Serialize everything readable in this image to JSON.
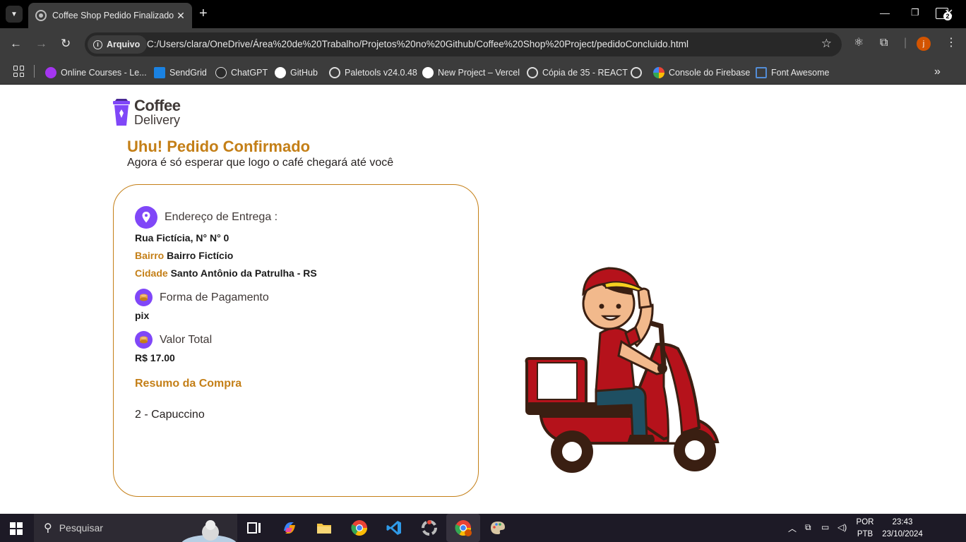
{
  "browser": {
    "tab_title": "Coffee Shop Pedido Finalizado",
    "site_info_label": "Arquivo",
    "url": "C:/Users/clara/OneDrive/Área%20de%20Trabalho/Projetos%20no%20Github/Coffee%20Shop%20Project/pedidoConcluido.html",
    "profile_initial": "j",
    "bookmarks": [
      {
        "label": "Online Courses - Le...",
        "icon": "udemy-icon",
        "color": "#a435f0"
      },
      {
        "label": "SendGrid",
        "icon": "sendgrid-icon",
        "color": "#1a82e2"
      },
      {
        "label": "ChatGPT",
        "icon": "chatgpt-icon",
        "color": "#dddddd"
      },
      {
        "label": "GitHub",
        "icon": "github-icon",
        "color": "#ffffff"
      },
      {
        "label": "Paletools v24.0.48",
        "icon": "globe-icon",
        "color": "#dddddd"
      },
      {
        "label": "New Project – Vercel",
        "icon": "vercel-icon",
        "color": "#ffffff"
      },
      {
        "label": "Cópia de 35 - REACT",
        "icon": "globe-icon",
        "color": "#dddddd"
      },
      {
        "label": "",
        "icon": "globe-icon",
        "color": "#dddddd"
      },
      {
        "label": "Console do Firebase",
        "icon": "google-icon",
        "color": "#4285f4"
      },
      {
        "label": "Font Awesome",
        "icon": "flag-icon",
        "color": "#538dd7"
      }
    ]
  },
  "page": {
    "logo_line1": "Coffee",
    "logo_line2": "Delivery",
    "title": "Uhu! Pedido Confirmado",
    "subtitle": "Agora é só esperar que logo o café chegará até você",
    "address_label": "Endereço de Entrega :",
    "street": "Rua Fictícia, N° N° 0",
    "bairro_label": "Bairro",
    "bairro_value": "Bairro Fictício",
    "cidade_label": "Cidade",
    "cidade_value": "Santo Antônio da Patrulha - RS",
    "payment_label": "Forma de Pagamento",
    "payment_value": "pix",
    "total_label": "Valor Total",
    "total_value": "R$ 17.00",
    "summary_title": "Resumo da Compra",
    "items": [
      "2 - Capuccino"
    ]
  },
  "taskbar": {
    "search_placeholder": "Pesquisar",
    "lang_line1": "POR",
    "lang_line2": "PTB",
    "time": "23:43",
    "date": "23/10/2024",
    "notification_count": "2"
  },
  "colors": {
    "accent": "#c47f17",
    "purple": "#8047f8",
    "card_border": "#c47f17"
  }
}
